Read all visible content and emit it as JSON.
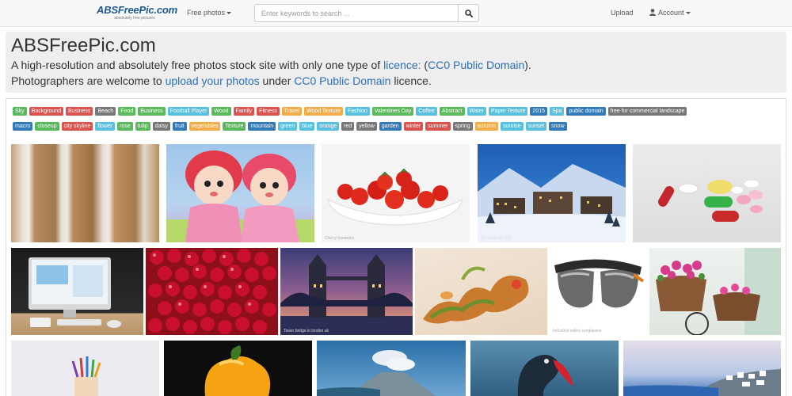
{
  "nav": {
    "brand": "ABSFreePic.com",
    "brand_tagline": "absolutely free pictures",
    "free_photos": "Free photos",
    "search_placeholder": "Enter keywords to search ...",
    "upload": "Upload",
    "account": "Account"
  },
  "hero": {
    "title": "ABSFreePic.com",
    "line1_prefix": "A high-resolution and absolutely free photos stock site with only one type of",
    "line1_link": "licence:",
    "line1_paren_open": "(",
    "line1_link2": "CC0 Public Domain",
    "line1_suffix": ").",
    "line2_prefix": "Photographers are welcome to",
    "line2_link": "upload your photos",
    "line2_mid": "under",
    "line2_link2": "CC0 Public Domain",
    "line2_suffix": "licence."
  },
  "tags_row1": [
    {
      "label": "Sky",
      "color": "#5cb85c"
    },
    {
      "label": "Background",
      "color": "#d9534f"
    },
    {
      "label": "Business",
      "color": "#d9534f"
    },
    {
      "label": "Beach",
      "color": "#777777"
    },
    {
      "label": "Food",
      "color": "#5cb85c"
    },
    {
      "label": "Business",
      "color": "#5cb85c"
    },
    {
      "label": "Football Player",
      "color": "#5bc0de"
    },
    {
      "label": "Wood",
      "color": "#5cb85c"
    },
    {
      "label": "Family",
      "color": "#d9534f"
    },
    {
      "label": "Fitness",
      "color": "#d9534f"
    },
    {
      "label": "Travel",
      "color": "#f0ad4e"
    },
    {
      "label": "Wood Texture",
      "color": "#f0ad4e"
    },
    {
      "label": "Fashion",
      "color": "#5bc0de"
    },
    {
      "label": "Valentines Day",
      "color": "#5cb85c"
    },
    {
      "label": "Coffee",
      "color": "#5bc0de"
    },
    {
      "label": "Abstract",
      "color": "#5cb85c"
    },
    {
      "label": "Water",
      "color": "#5bc0de"
    },
    {
      "label": "Paper Texture",
      "color": "#5bc0de"
    },
    {
      "label": "2015",
      "color": "#337ab7"
    },
    {
      "label": "Spa",
      "color": "#5bc0de"
    },
    {
      "label": "public domain",
      "color": "#337ab7"
    },
    {
      "label": "free for commercial landscape",
      "color": "#777777"
    }
  ],
  "tags_row2": [
    {
      "label": "macro",
      "color": "#337ab7"
    },
    {
      "label": "closeup",
      "color": "#5cb85c"
    },
    {
      "label": "city skyline",
      "color": "#d9534f"
    },
    {
      "label": "flower",
      "color": "#5bc0de"
    },
    {
      "label": "rose",
      "color": "#5cb85c"
    },
    {
      "label": "tulip",
      "color": "#5cb85c"
    },
    {
      "label": "daisy",
      "color": "#777777"
    },
    {
      "label": "fruit",
      "color": "#337ab7"
    },
    {
      "label": "vegetables",
      "color": "#f0ad4e"
    },
    {
      "label": "Texture",
      "color": "#5cb85c"
    },
    {
      "label": "mountain",
      "color": "#337ab7"
    },
    {
      "label": "green",
      "color": "#5bc0de"
    },
    {
      "label": "blue",
      "color": "#5bc0de"
    },
    {
      "label": "orange",
      "color": "#5bc0de"
    },
    {
      "label": "red",
      "color": "#777777"
    },
    {
      "label": "yellow",
      "color": "#777777"
    },
    {
      "label": "garden",
      "color": "#337ab7"
    },
    {
      "label": "winter",
      "color": "#d9534f"
    },
    {
      "label": "summer",
      "color": "#d9534f"
    },
    {
      "label": "spring",
      "color": "#777777"
    },
    {
      "label": "autumn",
      "color": "#f0ad4e"
    },
    {
      "label": "sunrise",
      "color": "#5bc0de"
    },
    {
      "label": "sunset",
      "color": "#5bc0de"
    },
    {
      "label": "snow",
      "color": "#337ab7"
    }
  ],
  "photos": {
    "p3_caption": "Cherry tomatoes",
    "p4_caption": "Ski resort at night",
    "p8_caption": "Tower bridge in london uk",
    "p10_caption": "Industrial safety sunglasses"
  }
}
